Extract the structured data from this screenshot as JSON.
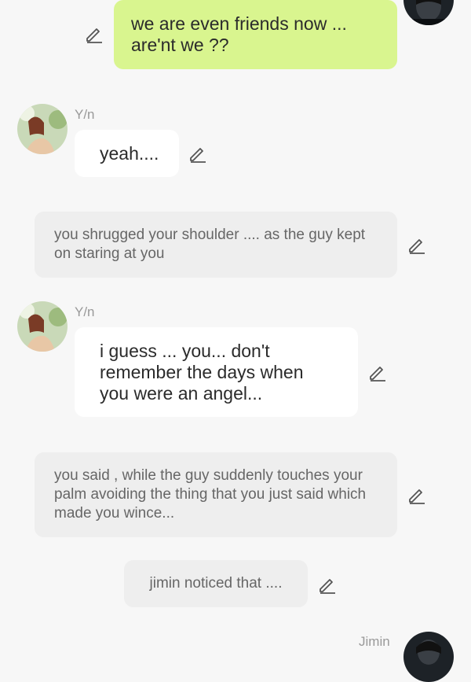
{
  "messages": [
    {
      "type": "sent",
      "text": "we are even friends now ... are'nt we ??"
    },
    {
      "type": "received",
      "sender": "Y/n",
      "text": "yeah...."
    },
    {
      "type": "narration",
      "text": "you shrugged your shoulder .... as the guy kept on staring at you"
    },
    {
      "type": "received",
      "sender": "Y/n",
      "text": "i guess ... you... don't remember the days when you were an angel..."
    },
    {
      "type": "narration",
      "text": "you said , while the guy suddenly touches your palm avoiding the thing that you just said which made you wince..."
    },
    {
      "type": "narration",
      "text": "jimin noticed that ...."
    },
    {
      "type": "sender_label",
      "sender": "Jimin"
    }
  ],
  "icons": {
    "edit": "pencil-edit-icon",
    "avatar_yn": "avatar-yn",
    "avatar_jimin": "avatar-jimin"
  },
  "colors": {
    "background": "#f7f7f7",
    "sent_bubble": "#d9f58f",
    "received_bubble": "#ffffff",
    "narration_bubble": "#eeeeee",
    "sender_name": "#999999"
  }
}
